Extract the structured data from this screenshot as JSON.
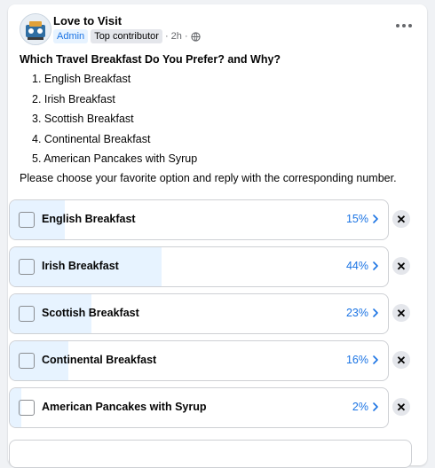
{
  "post": {
    "author": "Love to Visit",
    "admin_badge": "Admin",
    "contributor_badge": "Top contributor",
    "time": "· 2h ·",
    "question": "Which Travel Breakfast Do You Prefer? and Why?",
    "options_text": [
      "1. English Breakfast",
      "2. Irish Breakfast",
      "3. Scottish Breakfast",
      "4. Continental Breakfast",
      "5. American Pancakes with Syrup"
    ],
    "instruction": "Please choose your favorite option and reply with the corresponding number."
  },
  "poll": {
    "options": [
      {
        "label": "English Breakfast",
        "percent_text": "15%",
        "percent": 15
      },
      {
        "label": "Irish Breakfast",
        "percent_text": "44%",
        "percent": 44
      },
      {
        "label": "Scottish Breakfast",
        "percent_text": "23%",
        "percent": 23
      },
      {
        "label": "Continental Breakfast",
        "percent_text": "16%",
        "percent": 16
      },
      {
        "label": "American Pancakes with Syrup",
        "percent_text": "2%",
        "percent": 2
      }
    ]
  },
  "colors": {
    "accent": "#1b74e4",
    "fill": "#e7f3ff"
  }
}
